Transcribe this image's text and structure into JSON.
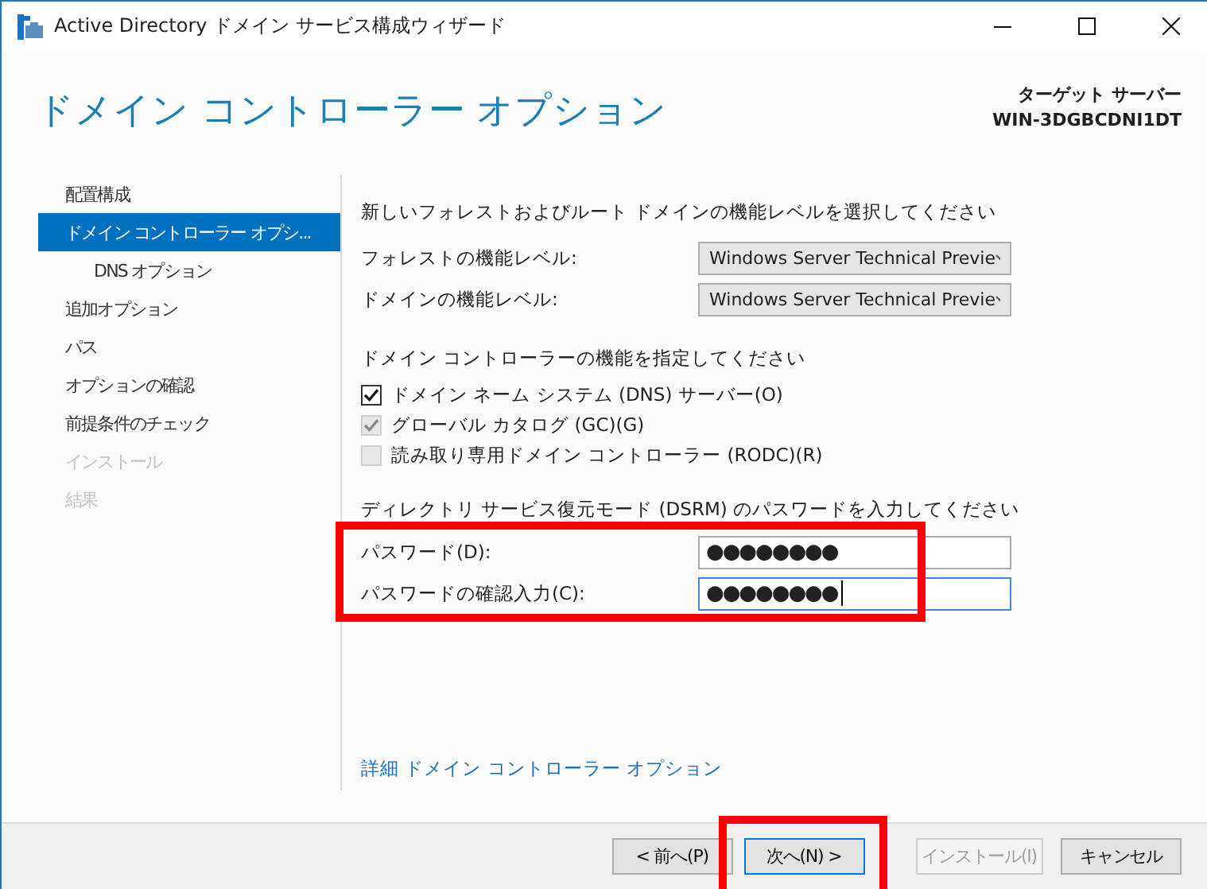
{
  "window": {
    "title": "Active Directory ドメイン サービス構成ウィザード"
  },
  "header": {
    "title": "ドメイン コントローラー オプション",
    "target_label": "ターゲット サーバー",
    "target_server": "WIN-3DGBCDNI1DT"
  },
  "nav": {
    "items": [
      {
        "label": "配置構成",
        "selected": false,
        "disabled": false
      },
      {
        "label": "ドメイン コントローラー オプシ...",
        "selected": true,
        "disabled": false,
        "children": [
          {
            "label": "DNS オプション",
            "selected": false,
            "disabled": false
          }
        ]
      },
      {
        "label": "追加オプション",
        "selected": false,
        "disabled": false
      },
      {
        "label": "パス",
        "selected": false,
        "disabled": false
      },
      {
        "label": "オプションの確認",
        "selected": false,
        "disabled": false
      },
      {
        "label": "前提条件のチェック",
        "selected": false,
        "disabled": false
      },
      {
        "label": "インストール",
        "selected": false,
        "disabled": true
      },
      {
        "label": "結果",
        "selected": false,
        "disabled": true
      }
    ]
  },
  "levels": {
    "heading": "新しいフォレストおよびルート ドメインの機能レベルを選択してください",
    "fields": [
      {
        "label": "フォレストの機能レベル:",
        "value": "Windows Server Technical Previe"
      },
      {
        "label": "ドメインの機能レベル:",
        "value": "Windows Server Technical Previe"
      }
    ]
  },
  "capabilities": {
    "heading": "ドメイン コントローラーの機能を指定してください",
    "options": [
      {
        "label": "ドメイン ネーム システム (DNS) サーバー(O)",
        "checked": true,
        "disabled": false
      },
      {
        "label": "グローバル カタログ (GC)(G)",
        "checked": true,
        "disabled": true
      },
      {
        "label": "読み取り専用ドメイン コントローラー (RODC)(R)",
        "checked": false,
        "disabled": true
      }
    ]
  },
  "dsrm": {
    "heading": "ディレクトリ サービス復元モード (DSRM) のパスワードを入力してください",
    "highlighted": true,
    "fields": [
      {
        "label": "パスワード(D):",
        "value": "●●●●●●●●",
        "focused": false
      },
      {
        "label": "パスワードの確認入力(C):",
        "value": "●●●●●●●●",
        "focused": true
      }
    ]
  },
  "link": "詳細 ドメイン コントローラー オプション",
  "buttons": [
    {
      "label": "< 前へ(P)",
      "disabled": false,
      "focused": false,
      "highlighted": false
    },
    {
      "label": "次へ(N) >",
      "disabled": false,
      "focused": true,
      "highlighted": true
    },
    {
      "label": "インストール(I)",
      "disabled": true,
      "focused": false,
      "highlighted": false
    },
    {
      "label": "キャンセル",
      "disabled": false,
      "focused": false,
      "highlighted": false
    }
  ]
}
